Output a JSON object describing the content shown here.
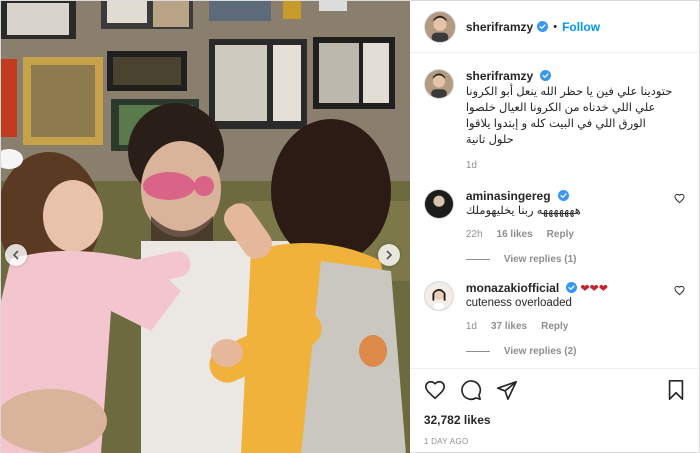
{
  "author": {
    "username": "sherifr​amzy",
    "follow_label": "Follow",
    "dot": "•"
  },
  "caption": {
    "username": "sherifr​amzy",
    "text": "حتودينا علي فين يا حظر الله ينعل أبو الكرونا علي اللي خدناه من الكرونا العيال خلصوا الورق اللي في البيت كله و إبتدوا يلاقوا حلول تانية",
    "time": "1d"
  },
  "comments": [
    {
      "username": "aminasingereg",
      "text": "هههههههه ربنا يخليهوملك",
      "time": "22h",
      "likes": "16 likes",
      "reply_label": "Reply",
      "view_replies": "View replies (1)"
    },
    {
      "username": "monazakiofficial",
      "hearts": "❤❤❤",
      "text": "cuteness overloaded",
      "time": "1d",
      "likes": "37 likes",
      "reply_label": "Reply",
      "view_replies": "View replies (2)"
    }
  ],
  "post": {
    "likes": "32,782 likes",
    "date": "1 DAY AGO"
  },
  "colors": {
    "accent": "#0095f6",
    "verified": "#3897f0",
    "text": "#262626",
    "muted": "#8e8e8e",
    "heart": "#c4222e"
  },
  "icons": [
    "heart-icon",
    "comment-icon",
    "share-icon",
    "save-icon",
    "verified-badge-icon",
    "chevron-left-icon",
    "chevron-right-icon"
  ]
}
